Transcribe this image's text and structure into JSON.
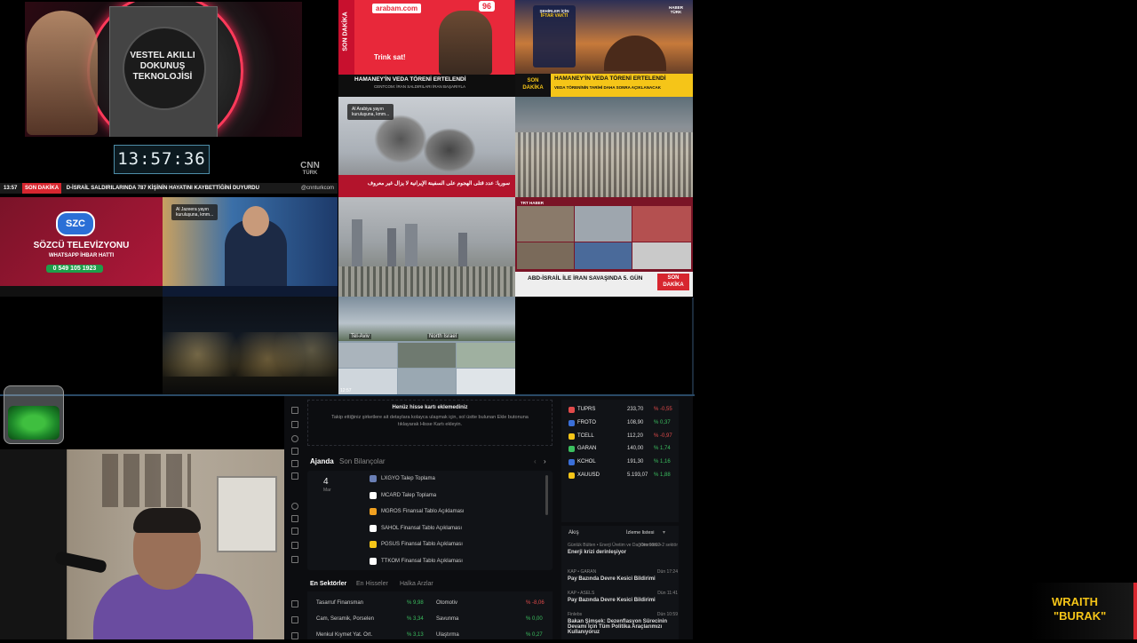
{
  "clock": "13:57:36",
  "tiles": {
    "vestel_ad": {
      "headline": "VESTEL AKILLI DOKUNUŞ TEKNOLOJİSİ"
    },
    "cnn": {
      "time": "13:57",
      "flag": "SON DAKİKA",
      "text": "D-İSRAİL SALDIRILARINDA 787 KİŞİNİN HAYATINI KAYBETTİĞİNİ DUYURDU",
      "logo_line1": "CNN",
      "logo_line2": "TÜRK",
      "handle": "@cnnturkcom"
    },
    "arabam": {
      "vertical_flag": "SON DAKİKA",
      "brand": "arabam.com",
      "badge": "96",
      "slogan": "Trink sat!",
      "ticker": "HAMANEY'İN VEDA TÖRENİ ERTELENDİ",
      "sub": "CENTCOM: İRAN SALDIRILARI İRAN BAŞARIYLA"
    },
    "haberturk": {
      "card_line1": "ŞEHİRLER İÇİN",
      "card_line2": "İFTAR VAKTİ",
      "logo": "HABER TÜRK",
      "flag_line1": "SON",
      "flag_line2": "DAKİKA",
      "ticker": "HAMANEY'İN VEDA TÖRENİ ERTELENDİ",
      "sub": "VEDA TÖRENİNİN TARİHİ DAHA SONRA AÇIKLANACAK"
    },
    "alarabiya": {
      "caption_line1": "Al Arabiya yayın",
      "caption_line2": "kuruluşuna, kmm...",
      "ticker": "سوريا: عدد قتلى الهجوم على السفينة الإيرانية لا يزال غير معروف"
    },
    "szc": {
      "logo": "SZC",
      "name": "SÖZCÜ TELEVİZYONU",
      "hotline": "WHATSAPP İHBAR HATTI",
      "phone": "0 549 105 1923"
    },
    "aljazeera": {
      "caption_line1": "Al Jazeera yayın",
      "caption_line2": "kuruluşuna, kmm..."
    },
    "trthaber": {
      "logo": "TRT HABER",
      "ticker": "ABD-İSRAİL İLE İRAN SAVAŞINDA 5. GÜN",
      "flag_line1": "SON",
      "flag_line2": "DAKİKA"
    },
    "cams": {
      "label_left": "Tel-Aviv",
      "label_right": "North Israel",
      "time": "12:57"
    }
  },
  "finance": {
    "empty_title": "Henüz hisse kartı eklemediniz",
    "empty_text": "Takip ettiğiniz şirketlere ait detaylara kolayca ulaşmak için, sol üstte bulunan Ekle butonuna tıklayarak Hisse Kartı ekleyin.",
    "tabs": [
      "Ajanda",
      "Son Bilançolar"
    ],
    "date_day": "4",
    "date_month": "Mar",
    "calendar": [
      {
        "label": "LXGYO Talep Toplama",
        "color": "#6a7fb5"
      },
      {
        "label": "MCARD Talep Toplama",
        "color": "#ffffff"
      },
      {
        "label": "MGROS Finansal Tablo Açıklaması",
        "color": "#f0a020"
      },
      {
        "label": "SAHOL Finansal Tablo Açıklaması",
        "color": "#ffffff"
      },
      {
        "label": "PGSUS Finansal Tablo Açıklaması",
        "color": "#f5c518"
      },
      {
        "label": "TTKOM Finansal Tablo Açıklaması",
        "color": "#ffffff"
      }
    ],
    "sector_tabs": [
      "En Sektörler",
      "En Hisseler",
      "Halka Arzlar"
    ],
    "sectors": [
      {
        "name": "Tasarruf Finansman",
        "change": "% 9,98",
        "name2": "Otomotiv",
        "change2": "% -8,06",
        "c1": "#3bbf5f",
        "c2": "#e24b4b"
      },
      {
        "name": "Cam, Seramik, Porselen",
        "change": "% 3,34",
        "name2": "Savunma",
        "change2": "% 0,00",
        "c1": "#3bbf5f",
        "c2": "#3bbf5f"
      },
      {
        "name": "Menkul Kıymet Yat. Ort.",
        "change": "% 3,13",
        "name2": "Ulaştırma",
        "change2": "% 0,27",
        "c1": "#3bbf5f",
        "c2": "#3bbf5f"
      }
    ],
    "stocks": [
      {
        "symbol": "TUPRS",
        "price": "233,70",
        "change": "% -0,55",
        "color": "#e24b4b",
        "icon": "#e24b4b"
      },
      {
        "symbol": "FROTO",
        "price": "108,90",
        "change": "% 0,37",
        "color": "#3bbf5f",
        "icon": "#3a6fd8"
      },
      {
        "symbol": "TCELL",
        "price": "112,20",
        "change": "% -0,97",
        "color": "#e24b4b",
        "icon": "#f5c518"
      },
      {
        "symbol": "GARAN",
        "price": "140,00",
        "change": "% 1,74",
        "color": "#3bbf5f",
        "icon": "#3bbf5f"
      },
      {
        "symbol": "KCHOL",
        "price": "191,30",
        "change": "% 1,16",
        "color": "#3bbf5f",
        "icon": "#3a6fd8"
      },
      {
        "symbol": "XAUUSD",
        "price": "5.193,07",
        "change": "% 1,88",
        "color": "#3bbf5f",
        "icon": "#f5c518"
      }
    ],
    "news_header_left": "Akış",
    "news_header_right": "İzleme listesi",
    "news": [
      {
        "meta": "Günlük Bülten • Enerji Üretim ve Dağıtım 09:02",
        "meta2": "Otomotiv +2 sektör",
        "title": "Enerji krizi derinleşiyor"
      },
      {
        "meta": "KAP • GARAN",
        "meta2": "Dün 17:24",
        "title": "Pay Bazında Devre Kesici Bildirimi"
      },
      {
        "meta": "KAP • ASELS",
        "meta2": "Dün 11:41",
        "title": "Pay Bazında Devre Kesici Bildirimi"
      },
      {
        "meta": "Finlebs",
        "meta2": "Dün 10:59",
        "title": "Bakan Şimşek: Dezenflasyon Sürecinin Devamı İçin Tüm Politika Araçlarımızı Kullanıyoruz"
      }
    ]
  },
  "overlay": {
    "brand_line1": "WRAITH",
    "brand_line2": "\"BURAK\""
  },
  "colors": {
    "finance_bg": "#0c0d10",
    "accent_red": "#d7262f",
    "up": "#3bbf5f",
    "down": "#e24b4b"
  }
}
